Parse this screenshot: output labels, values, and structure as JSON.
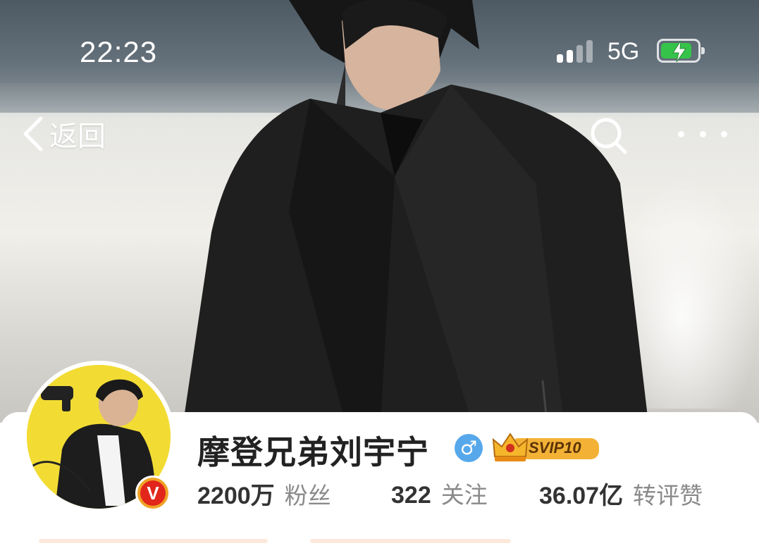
{
  "status_bar": {
    "time": "22:23",
    "network": "5G"
  },
  "nav": {
    "back_label": "返回"
  },
  "profile": {
    "name": "摩登兄弟刘宇宁",
    "gender_symbol": "♂",
    "vip_badge": "SVIP10",
    "verified_symbol": "V"
  },
  "stats": [
    {
      "number": "2200",
      "unit": "万",
      "label": "粉丝"
    },
    {
      "number": "322",
      "unit": "",
      "label": "关注"
    },
    {
      "number": "36.07",
      "unit": "亿",
      "label": "转评赞"
    }
  ],
  "colors": {
    "battery": "#36c34a",
    "gender_badge": "#57a8ea",
    "verified": "#e2261b",
    "vip": "#f3b236"
  }
}
